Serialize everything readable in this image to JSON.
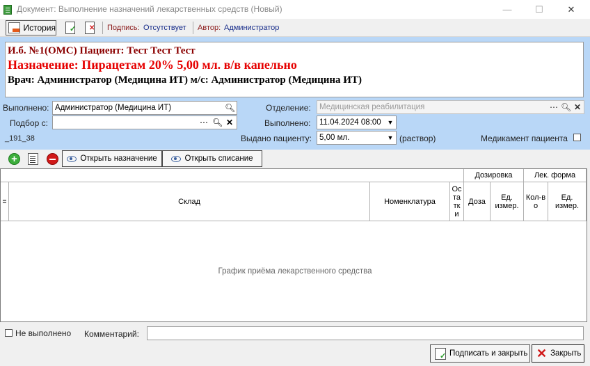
{
  "window": {
    "title": "Документ: Выполнение назначений лекарственных средств (Новый)",
    "minimize": "—",
    "maximize": "☐",
    "close": "✕"
  },
  "toolbar": {
    "history_label": "История",
    "signature_label": "Подпись:",
    "signature_value": "Отсутствует",
    "author_label": "Автор:",
    "author_value": "Администратор"
  },
  "header": {
    "line1": "И.б. №1(ОМС) Пациент: Тест Тест Тест",
    "line2": "Назначение: Пирацетам 20% 5,00 мл. в/в капельно",
    "line3": "Врач: Администратор (Медицина ИТ) м/с: Администратор (Медицина ИТ)"
  },
  "form": {
    "performed_by_label": "Выполнено:",
    "performed_by_value": "Администратор (Медицина ИТ)",
    "selection_label": "Подбор с:",
    "selection_value": "",
    "code": "_191_38",
    "department_label": "Отделение:",
    "department_value": "Медицинская реабилитация",
    "performed_date_label": "Выполнено:",
    "performed_date_value": "11.04.2024 08:00",
    "given_label": "Выдано пациенту:",
    "given_value": "5,00 мл.",
    "given_unit": "(раствор)",
    "patient_med_label": "Медикамент пациента"
  },
  "grid_toolbar": {
    "open_prescription": "Открыть назначение",
    "open_writeoff": "Открыть списание"
  },
  "grid": {
    "group_dosage": "Дозировка",
    "group_form": "Лек. форма",
    "col_warehouse": "Склад",
    "col_nomenclature": "Номенклатура",
    "col_remains": "Ос\nта\nтк\nи",
    "col_dose": "Доза",
    "col_dose_unit": "Ед.\nизмер.",
    "col_qty": "Кол-в\nо",
    "col_form_unit": "Ед.\nизмер.",
    "empty_text": "График приёма лекарственного средства"
  },
  "bottom": {
    "not_done_label": "Не выполнено",
    "comment_label": "Комментарий:",
    "comment_value": "",
    "sign_close": "Подписать и закрыть",
    "close": "Закрыть"
  }
}
